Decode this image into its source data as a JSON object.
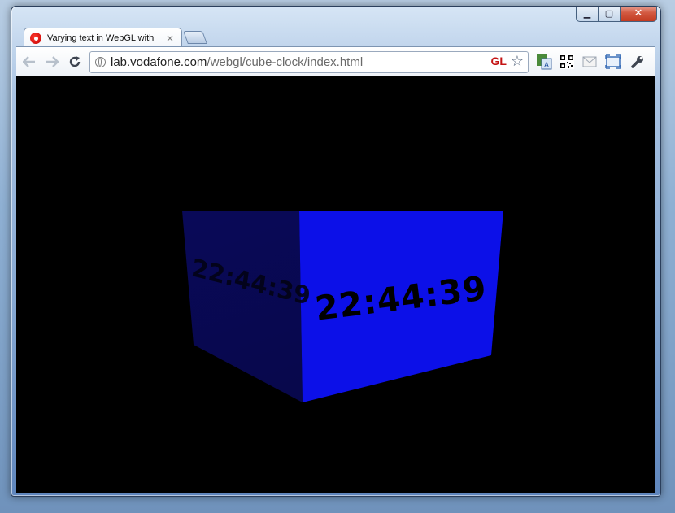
{
  "tab": {
    "title": "Varying text in WebGL with",
    "close": "×"
  },
  "window_controls": {
    "minimize": "▁",
    "maximize": "▢",
    "close": "✕"
  },
  "toolbar": {
    "url_domain": "lab.vodafone.com",
    "url_path": "/webgl/cube-clock/index.html",
    "gl_badge": "GL",
    "back_icon": "back-arrow-icon",
    "forward_icon": "forward-arrow-icon",
    "reload_icon": "reload-icon",
    "extensions": [
      "translate-icon",
      "qr-code-icon",
      "mail-icon",
      "fullscreen-icon",
      "wrench-icon"
    ]
  },
  "content": {
    "clock_front": "22:44:39",
    "clock_side": "22:44:39"
  },
  "colors": {
    "cube_front": "#0c10e8",
    "cube_side": "#07073f",
    "background": "#000000"
  }
}
